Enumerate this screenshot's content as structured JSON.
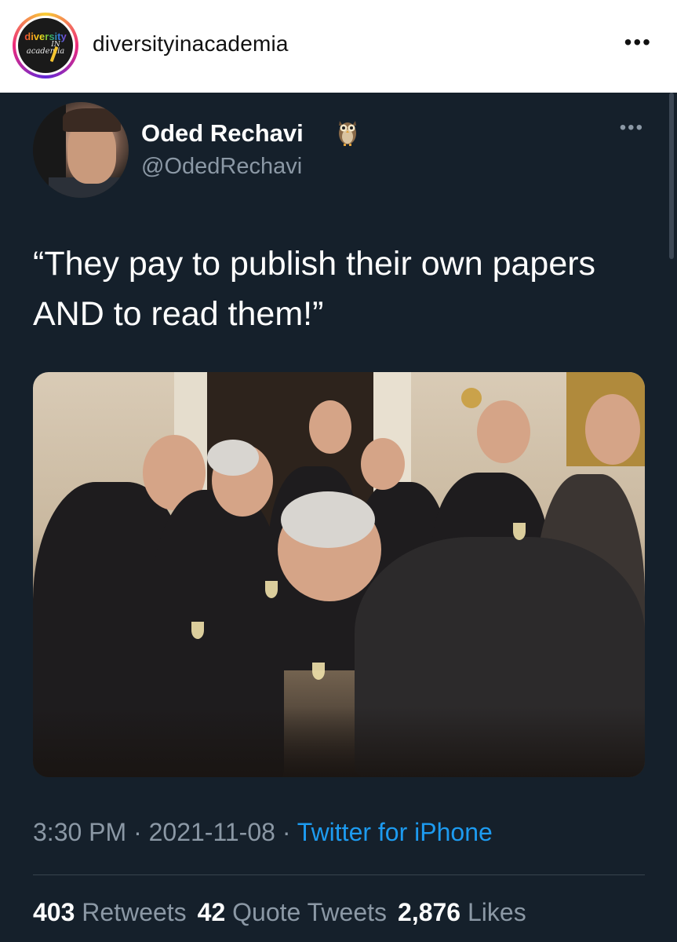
{
  "instagram": {
    "username": "diversityinacademia",
    "avatar_logo_top": "diversity",
    "avatar_logo_in": "IN",
    "avatar_logo_bottom": "academia",
    "more_icon": "more-horizontal-icon"
  },
  "tweet": {
    "author_name": "Oded Rechavi",
    "author_emoji": "owl-emoji",
    "author_handle": "@OdedRechavi",
    "more_icon": "more-horizontal-icon",
    "text": "“They pay to publish their own papers AND to read them!”",
    "time": "3:30 PM",
    "date": "2021-11-08",
    "separator": " · ",
    "source": "Twitter for iPhone",
    "stats": {
      "retweets_count": "403",
      "retweets_label": "Retweets",
      "quote_tweets_count": "42",
      "quote_tweets_label": "Quote Tweets",
      "likes_count": "2,876",
      "likes_label": "Likes"
    }
  },
  "colors": {
    "tweet_background": "#15202b",
    "secondary_text": "#8b98a5",
    "link": "#1d9bf0",
    "divider": "#38444d"
  }
}
